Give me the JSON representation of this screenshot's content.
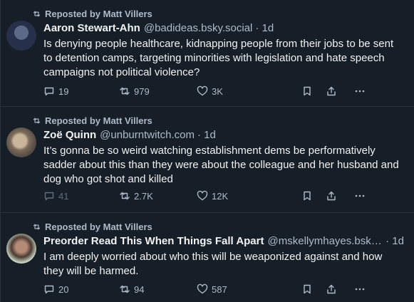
{
  "posts": [
    {
      "repost_label": "Reposted by Matt Villers",
      "name": "Aaron Stewart-Ahn",
      "handle": "@badideas.bsky.social",
      "time": "· 1d",
      "text": "Is denying people healthcare, kidnapping people from their jobs to be sent to detention camps, targeting minorities with legislation and hate speech campaigns not  political violence?",
      "replies": "19",
      "reposts": "979",
      "likes": "3K"
    },
    {
      "repost_label": "Reposted by Matt Villers",
      "name": "Zoë Quinn",
      "handle": "@unburntwitch.com",
      "time": "· 1d",
      "text": "It’s gonna be so weird watching establishment dems be performatively sadder about this than they were about the colleague and her husband and dog who got shot and killed",
      "replies": "41",
      "reposts": "2.7K",
      "likes": "12K"
    },
    {
      "repost_label": "Reposted by Matt Villers",
      "name": "Preorder Read This When Things Fall Apart",
      "handle": "@mskellymhayes.bsky...",
      "time": "· 1d",
      "text": "I am deeply worried about who this will be weaponized against and how they will be harmed.",
      "replies": "20",
      "reposts": "94",
      "likes": "587"
    }
  ],
  "icons": {
    "repost": "repost-icon",
    "reply": "reply-icon",
    "like": "heart-icon",
    "bookmark": "bookmark-icon",
    "share": "share-icon",
    "more": "more-icon"
  },
  "colors": {
    "background": "#161e27",
    "text": "#f1f3f5",
    "muted": "#aebbc9",
    "divider": "#2a343f"
  }
}
